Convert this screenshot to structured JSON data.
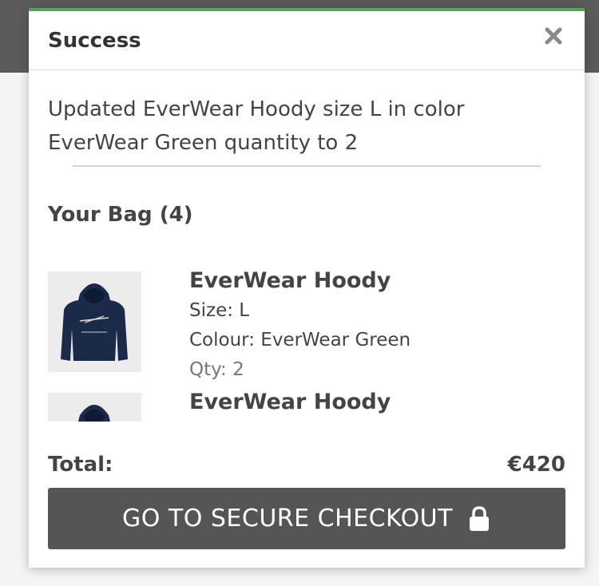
{
  "toast": {
    "title": "Success",
    "message": "Updated EverWear Hoody size L in color EverWear Green quantity to 2",
    "close_icon": "close-icon"
  },
  "bag": {
    "title": "Your Bag (4)",
    "items": [
      {
        "name": "EverWear Hoody",
        "size": "Size: L",
        "colour": "Colour: EverWear Green",
        "qty": "Qty: 2",
        "image": "navy hoodie product thumbnail"
      },
      {
        "name": "EverWear Hoody",
        "size": "",
        "colour": "",
        "qty": "",
        "image": "navy hoodie product thumbnail"
      }
    ]
  },
  "total": {
    "label": "Total:",
    "value": "€420"
  },
  "checkout": {
    "label": "GO TO SECURE CHECKOUT",
    "icon": "lock-icon"
  },
  "colors": {
    "accent_top_border": "#54a455",
    "button_bg": "#555555",
    "text": "#444444"
  }
}
